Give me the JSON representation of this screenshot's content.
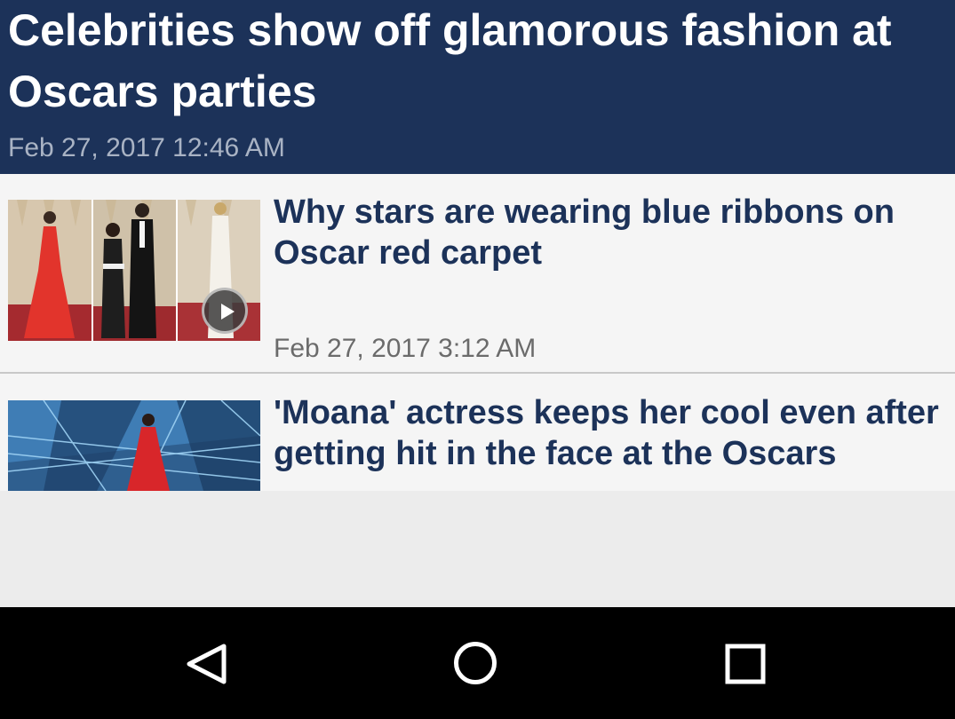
{
  "hero": {
    "title": "Celebrities show off glamorous fashion at Oscars parties",
    "date": "Feb 27, 2017 12:46 AM"
  },
  "articles": [
    {
      "headline": "Why stars are wearing blue ribbons on Oscar red carpet",
      "date": "Feb 27, 2017 3:12 AM",
      "has_video": true
    },
    {
      "headline": "'Moana' actress keeps her cool even after getting hit in the face at the Oscars"
    }
  ],
  "colors": {
    "header_bg": "#1c3259",
    "headline": "#1c3259",
    "date_text": "#6b6b6b",
    "list_bg": "#f5f5f5",
    "nav_bg": "#000000"
  },
  "navbar": {
    "buttons": [
      "back-icon",
      "home-icon",
      "recent-apps-icon"
    ]
  }
}
